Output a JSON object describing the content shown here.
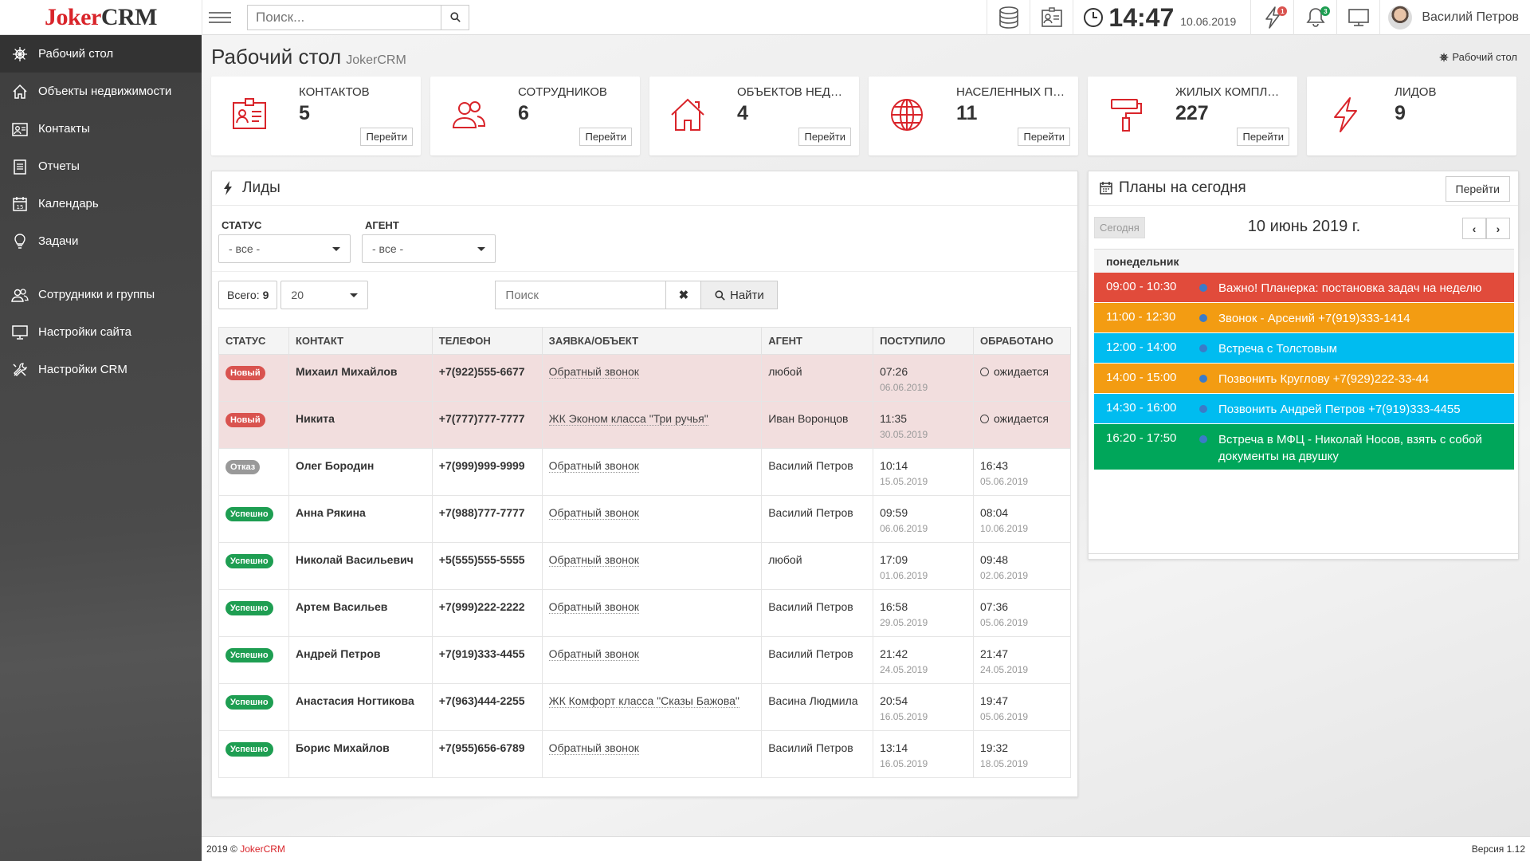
{
  "app": {
    "logo_a": "Joker",
    "logo_b": "CRM"
  },
  "topbar": {
    "search_placeholder": "Поиск...",
    "time": "14:47",
    "date": "10.06.2019",
    "notif_lightning": "1",
    "notif_bell": "3",
    "user_name": "Василий Петров"
  },
  "sidebar": {
    "items": [
      {
        "label": "Рабочий стол",
        "icon": "ship-wheel-icon"
      },
      {
        "label": "Объекты недвижимости",
        "icon": "home-icon"
      },
      {
        "label": "Контакты",
        "icon": "contacts-icon"
      },
      {
        "label": "Отчеты",
        "icon": "reports-icon"
      },
      {
        "label": "Календарь",
        "icon": "calendar-icon"
      },
      {
        "label": "Задачи",
        "icon": "lightbulb-icon"
      },
      {
        "label": "Сотрудники и группы",
        "icon": "users-icon"
      },
      {
        "label": "Настройки сайта",
        "icon": "monitor-icon"
      },
      {
        "label": "Настройки CRM",
        "icon": "tools-icon"
      }
    ]
  },
  "page": {
    "title": "Рабочий стол",
    "subtitle": "JokerCRM",
    "breadcrumb": "Рабочий стол"
  },
  "stats": [
    {
      "label": "Контактов",
      "value": "5",
      "button": "Перейти",
      "icon": "contact-card-icon"
    },
    {
      "label": "Сотрудников",
      "value": "6",
      "button": "Перейти",
      "icon": "users-icon"
    },
    {
      "label": "Объектов недвижимости",
      "value": "4",
      "button": "Перейти",
      "icon": "house-icon"
    },
    {
      "label": "Населенных пунктов",
      "value": "11",
      "button": "Перейти",
      "icon": "globe-icon"
    },
    {
      "label": "Жилых комплексов",
      "value": "227",
      "button": "Перейти",
      "icon": "paint-roller-icon"
    },
    {
      "label": "Лидов",
      "value": "9",
      "button": "",
      "icon": "lightning-icon"
    }
  ],
  "leads": {
    "title": "Лиды",
    "filter_status_label": "Статус",
    "filter_status_value": "- все -",
    "filter_agent_label": "Агент",
    "filter_agent_value": "- все -",
    "total_label": "Всего:",
    "total_value": "9",
    "per_page": "20",
    "search_placeholder": "Поиск",
    "clear_label": "✖",
    "find_label": "Найти",
    "columns": [
      "Статус",
      "Контакт",
      "Телефон",
      "Заявка/Объект",
      "Агент",
      "Поступило",
      "Обработано"
    ],
    "rows": [
      {
        "status": "Новый",
        "kind": "new",
        "contact": "Михаил Михайлов",
        "phone": "+7(922)555-6677",
        "request": "Обратный звонок",
        "agent": "любой",
        "in_time": "07:26",
        "in_date": "06.06.2019",
        "done_time": "ожидается",
        "done_date": ""
      },
      {
        "status": "Новый",
        "kind": "new",
        "contact": "Никита",
        "phone": "+7(777)777-7777",
        "request": "ЖК Эконом класса \"Три ручья\"",
        "agent": "Иван Воронцов",
        "in_time": "11:35",
        "in_date": "30.05.2019",
        "done_time": "ожидается",
        "done_date": ""
      },
      {
        "status": "Отказ",
        "kind": "refuse",
        "contact": "Олег Бородин",
        "phone": "+7(999)999-9999",
        "request": "Обратный звонок",
        "agent": "Василий Петров",
        "in_time": "10:14",
        "in_date": "15.05.2019",
        "done_time": "16:43",
        "done_date": "05.06.2019"
      },
      {
        "status": "Успешно",
        "kind": "ok",
        "contact": "Анна Рякина",
        "phone": "+7(988)777-7777",
        "request": "Обратный звонок",
        "agent": "Василий Петров",
        "in_time": "09:59",
        "in_date": "06.06.2019",
        "done_time": "08:04",
        "done_date": "10.06.2019"
      },
      {
        "status": "Успешно",
        "kind": "ok",
        "contact": "Николай Васильевич",
        "phone": "+5(555)555-5555",
        "request": "Обратный звонок",
        "agent": "любой",
        "in_time": "17:09",
        "in_date": "01.06.2019",
        "done_time": "09:48",
        "done_date": "02.06.2019"
      },
      {
        "status": "Успешно",
        "kind": "ok",
        "contact": "Артем Васильев",
        "phone": "+7(999)222-2222",
        "request": "Обратный звонок",
        "agent": "Василий Петров",
        "in_time": "16:58",
        "in_date": "29.05.2019",
        "done_time": "07:36",
        "done_date": "05.06.2019"
      },
      {
        "status": "Успешно",
        "kind": "ok",
        "contact": "Андрей Петров",
        "phone": "+7(919)333-4455",
        "request": "Обратный звонок",
        "agent": "Василий Петров",
        "in_time": "21:42",
        "in_date": "24.05.2019",
        "done_time": "21:47",
        "done_date": "24.05.2019"
      },
      {
        "status": "Успешно",
        "kind": "ok",
        "contact": "Анастасия Ногтикова",
        "phone": "+7(963)444-2255",
        "request": "ЖК Комфорт класса \"Сказы Бажова\"",
        "agent": "Васина Людмила",
        "in_time": "20:54",
        "in_date": "16.05.2019",
        "done_time": "19:47",
        "done_date": "05.06.2019"
      },
      {
        "status": "Успешно",
        "kind": "ok",
        "contact": "Борис Михайлов",
        "phone": "+7(955)656-6789",
        "request": "Обратный звонок",
        "agent": "Василий Петров",
        "in_time": "13:14",
        "in_date": "16.05.2019",
        "done_time": "19:32",
        "done_date": "18.05.2019"
      }
    ]
  },
  "plans": {
    "title": "Планы на сегодня",
    "button": "Перейти",
    "today": "Сегодня",
    "date": "10 июнь 2019 г.",
    "prev": "‹",
    "next": "›",
    "weekday": "понедельник",
    "events": [
      {
        "time": "09:00 - 10:30",
        "text": "Важно! Планерка: постановка задач на неделю",
        "color": "#e14b3b"
      },
      {
        "time": "11:00 - 12:30",
        "text": "Звонок - Арсений +7(919)333-1414",
        "color": "#f39c12"
      },
      {
        "time": "12:00 - 14:00",
        "text": "Встреча с Толстовым",
        "color": "#00bcf0"
      },
      {
        "time": "14:00 - 15:00",
        "text": "Позвонить Круглову +7(929)222-33-44",
        "color": "#f39c12"
      },
      {
        "time": "14:30 - 16:00",
        "text": "Позвонить Андрей Петров +7(919)333-4455",
        "color": "#00bcf0"
      },
      {
        "time": "16:20 - 17:50",
        "text": "Встреча в МФЦ - Николай Носов, взять с собой документы на двушку",
        "color": "#00a65a"
      }
    ]
  },
  "footer": {
    "copyright": "2019 © ",
    "brand": "JokerCRM",
    "version": "Версия 1.12"
  },
  "colors": {
    "accent": "#d9242a",
    "sidebar": "#444444",
    "new_row": "#f2dede",
    "success": "#1e9e52"
  }
}
